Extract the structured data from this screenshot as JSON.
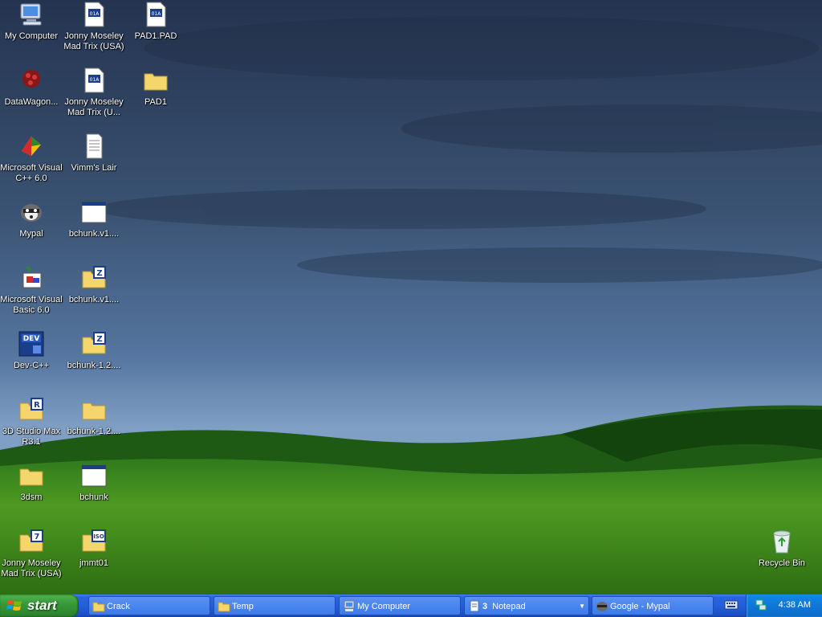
{
  "desktop": {
    "icons": [
      {
        "label": "My Computer",
        "type": "computer"
      },
      {
        "label": "DataWagon...",
        "type": "datawagon"
      },
      {
        "label": "Microsoft Visual C++ 6.0",
        "type": "vcpp"
      },
      {
        "label": "Mypal",
        "type": "mypal"
      },
      {
        "label": "Microsoft Visual Basic 6.0",
        "type": "vb"
      },
      {
        "label": "Dev-C++",
        "type": "devcpp"
      },
      {
        "label": "3D Studio Max R3.1",
        "type": "folder-r"
      },
      {
        "label": "3dsm",
        "type": "folder"
      },
      {
        "label": "Jonny Moseley Mad Trix (USA)",
        "type": "folder-7"
      },
      {
        "label": "Jonny Moseley Mad Trix (USA)",
        "type": "disc-file"
      },
      {
        "label": "Jonny Moseley Mad Trix (U...",
        "type": "disc-file"
      },
      {
        "label": "Vimm's Lair",
        "type": "textdoc"
      },
      {
        "label": "bchunk.v1....",
        "type": "exe"
      },
      {
        "label": "bchunk.v1....",
        "type": "folder-z"
      },
      {
        "label": "bchunk-1.2....",
        "type": "folder-z"
      },
      {
        "label": "bchunk-1.2....",
        "type": "folder"
      },
      {
        "label": "bchunk",
        "type": "exe"
      },
      {
        "label": "jmmt01",
        "type": "folder-iso"
      },
      {
        "label": "PAD1.PAD",
        "type": "disc-file"
      },
      {
        "label": "PAD1",
        "type": "folder"
      },
      {
        "label": "Recycle Bin",
        "type": "recycle"
      }
    ]
  },
  "taskbar": {
    "start_label": "start",
    "buttons": [
      {
        "label": "Crack",
        "icon": "folder-icon"
      },
      {
        "label": "Temp",
        "icon": "folder-icon"
      },
      {
        "label": "My Computer",
        "icon": "computer-icon"
      },
      {
        "count": "3",
        "label": "Notepad",
        "icon": "notepad-icon"
      },
      {
        "label": "Google - Mypal",
        "icon": "mypal-icon"
      }
    ],
    "clock": "4:38 AM"
  },
  "colors": {
    "taskbar": "#245edb",
    "start": "#389a38",
    "tray": "#0f77d6"
  }
}
